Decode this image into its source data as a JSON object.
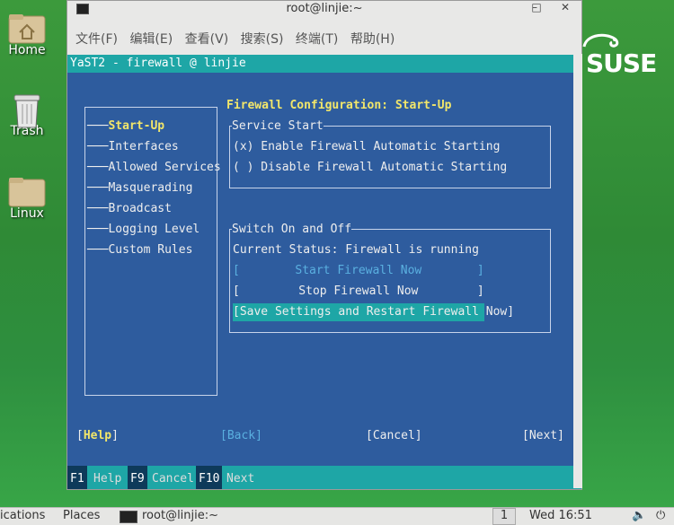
{
  "desktop": {
    "icons": [
      {
        "label": "Home"
      },
      {
        "label": "Trash"
      },
      {
        "label": "Linux"
      }
    ],
    "brand": "SUSE"
  },
  "window": {
    "title": "root@linjie:~",
    "menu": [
      "文件(F)",
      "编辑(E)",
      "查看(V)",
      "搜索(S)",
      "终端(T)",
      "帮助(H)"
    ]
  },
  "yast": {
    "header": "YaST2 - firewall @ linjie",
    "nav": [
      "Start-Up",
      "Interfaces",
      "Allowed Services",
      "Masquerading",
      "Broadcast",
      "Logging Level",
      "Custom Rules"
    ],
    "nav_selected": "Start-Up",
    "section_title": "Firewall Configuration: Start-Up",
    "service_start": {
      "label": "Service Start",
      "opt1": "(x) Enable Firewall Automatic Starting",
      "opt2": "( ) Disable Firewall Automatic Starting"
    },
    "switch": {
      "label": "Switch On and Off",
      "status": "Current Status: Firewall is running",
      "start_btn": "Start Firewall Now",
      "stop_btn": "Stop Firewall Now",
      "save_btn": "Save Settings and Restart Firewall Now"
    },
    "buttons": {
      "help": "Help",
      "back": "Back",
      "cancel": "Cancel",
      "next": "Next"
    },
    "fkeys": [
      {
        "key": "F1",
        "label": "Help"
      },
      {
        "key": "F9",
        "label": "Cancel"
      },
      {
        "key": "F10",
        "label": "Next"
      }
    ]
  },
  "taskbar": {
    "applications": "ications",
    "places": "Places",
    "task": "root@linjie:~",
    "workspace": "1",
    "clock": "Wed 16:51"
  }
}
